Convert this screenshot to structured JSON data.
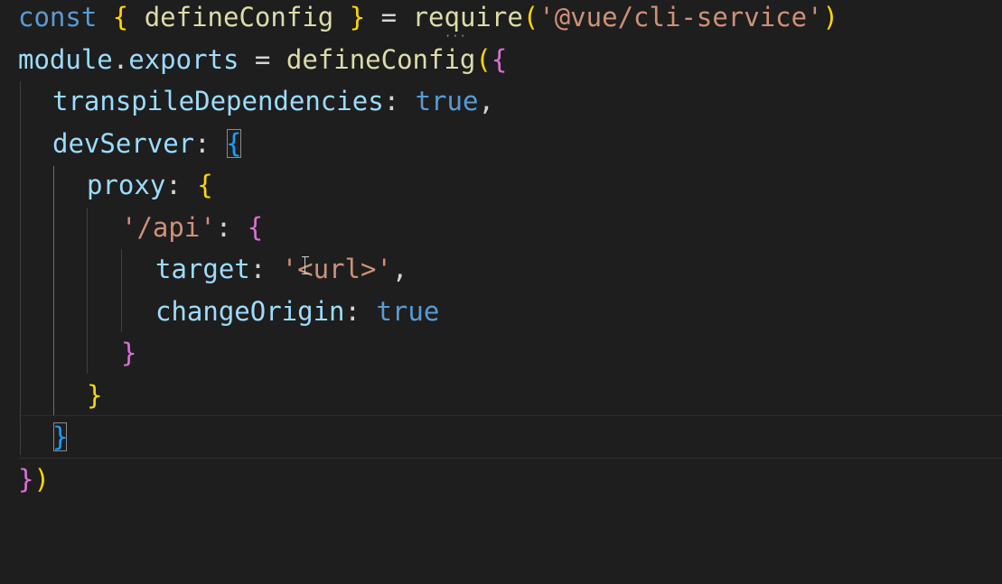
{
  "colors": {
    "background": "#1e1e1e",
    "keyword": "#569cd6",
    "variable": "#9cdcfe",
    "function": "#dcdcaa",
    "string": "#ce9178",
    "bracket_level_1": "#ffd700",
    "bracket_level_2": "#da70d6",
    "bracket_level_3": "#179fff"
  },
  "code": {
    "line1": {
      "const": "const",
      "open_brace": "{",
      "define_config": "defineConfig",
      "close_brace": "}",
      "equals": "=",
      "require": "require",
      "open_paren": "(",
      "module_path": "'@vue/cli-service'",
      "close_paren": ")"
    },
    "line2": {
      "module": "module",
      "dot": ".",
      "exports": "exports",
      "equals": "=",
      "define_config": "defineConfig",
      "open_paren": "(",
      "open_brace": "{"
    },
    "line3": {
      "key": "transpileDependencies",
      "colon": ":",
      "value": "true",
      "comma": ","
    },
    "line4": {
      "key": "devServer",
      "colon": ":",
      "open_brace": "{"
    },
    "line5": {
      "key": "proxy",
      "colon": ":",
      "open_brace": "{"
    },
    "line6": {
      "key": "'/api'",
      "colon": ":",
      "open_brace": "{"
    },
    "line7": {
      "key": "target",
      "colon": ":",
      "value": "'<url>'",
      "comma": ","
    },
    "line8": {
      "key": "changeOrigin",
      "colon": ":",
      "value": "true"
    },
    "line9": {
      "close_brace": "}"
    },
    "line10": {
      "close_brace": "}"
    },
    "line11": {
      "close_brace": "}"
    },
    "line12": {
      "close_brace": "}",
      "close_paren": ")"
    }
  }
}
